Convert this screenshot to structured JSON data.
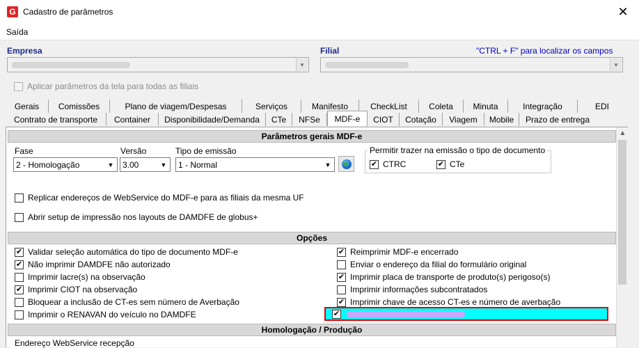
{
  "window": {
    "title": "Cadastro de parâmetros",
    "close_glyph": "✕"
  },
  "menu": {
    "items": [
      "Saída"
    ]
  },
  "header": {
    "empresa_label": "Empresa",
    "filial_label": "Filial",
    "search_hint": "\"CTRL + F\" para localizar os campos",
    "apply_all_label": "Aplicar parâmetros da tela para todas as filiais"
  },
  "tabs": {
    "row1": [
      "Gerais",
      "Comissões",
      "Plano de viagem/Despesas",
      "Serviços",
      "Manifesto",
      "CheckList",
      "Coleta",
      "Minuta",
      "Integração",
      "EDI"
    ],
    "row2": [
      "Contrato de transporte",
      "Container",
      "Disponibilidade/Demanda",
      "CTe",
      "NFSe",
      "MDF-e",
      "CIOT",
      "Cotação",
      "Viagem",
      "Mobile",
      "Prazo de entrega"
    ],
    "active": "MDF-e"
  },
  "general_section": {
    "title": "Parâmetros gerais MDF-e",
    "fase_label": "Fase",
    "fase_value": "2 - Homologação",
    "versao_label": "Versão",
    "versao_value": "3.00",
    "tipo_label": "Tipo de emissão",
    "tipo_value": "1 - Normal",
    "group_title": "Permitir trazer na emissão o tipo de documento",
    "ctrc_label": "CTRC",
    "cte_label": "CTe",
    "replicar_label": "Replicar endereços de WebService do MDF-e para as filiais da mesma UF",
    "setup_label": "Abrir setup de impressão nos layouts de DAMDFE de globus+"
  },
  "options_section": {
    "title": "Opções",
    "left": [
      {
        "label": "Validar seleção automática do tipo de documento MDF-e",
        "checked": true
      },
      {
        "label": "Não imprimir DAMDFE não autorizado",
        "checked": true
      },
      {
        "label": "Imprimir lacre(s) na observação",
        "checked": false
      },
      {
        "label": "Imprimir CIOT na observação",
        "checked": true
      },
      {
        "label": "Bloquear a inclusão de CT-es sem número de Averbação",
        "checked": false
      },
      {
        "label": "Imprimir o RENAVAN do veículo no DAMDFE",
        "checked": false
      }
    ],
    "right": [
      {
        "label": "Reimprimir MDF-e encerrado",
        "checked": true
      },
      {
        "label": "Enviar o endereço da filial do formulário original",
        "checked": false
      },
      {
        "label": "Imprimir placa de transporte de produto(s) perigoso(s)",
        "checked": true
      },
      {
        "label": "Imprimir informações subcontratados",
        "checked": false
      },
      {
        "label": "Imprimir chave de acesso CT-es e número de averbação",
        "checked": true
      }
    ],
    "highlighted_checked": true
  },
  "homologacao_section": {
    "title": "Homologação / Produção",
    "endereco_label": "Endereço WebService recepção"
  },
  "colors": {
    "highlight": "#00ffff",
    "highlight_border": "#e60000",
    "label_blue": "#1a2b8c"
  }
}
